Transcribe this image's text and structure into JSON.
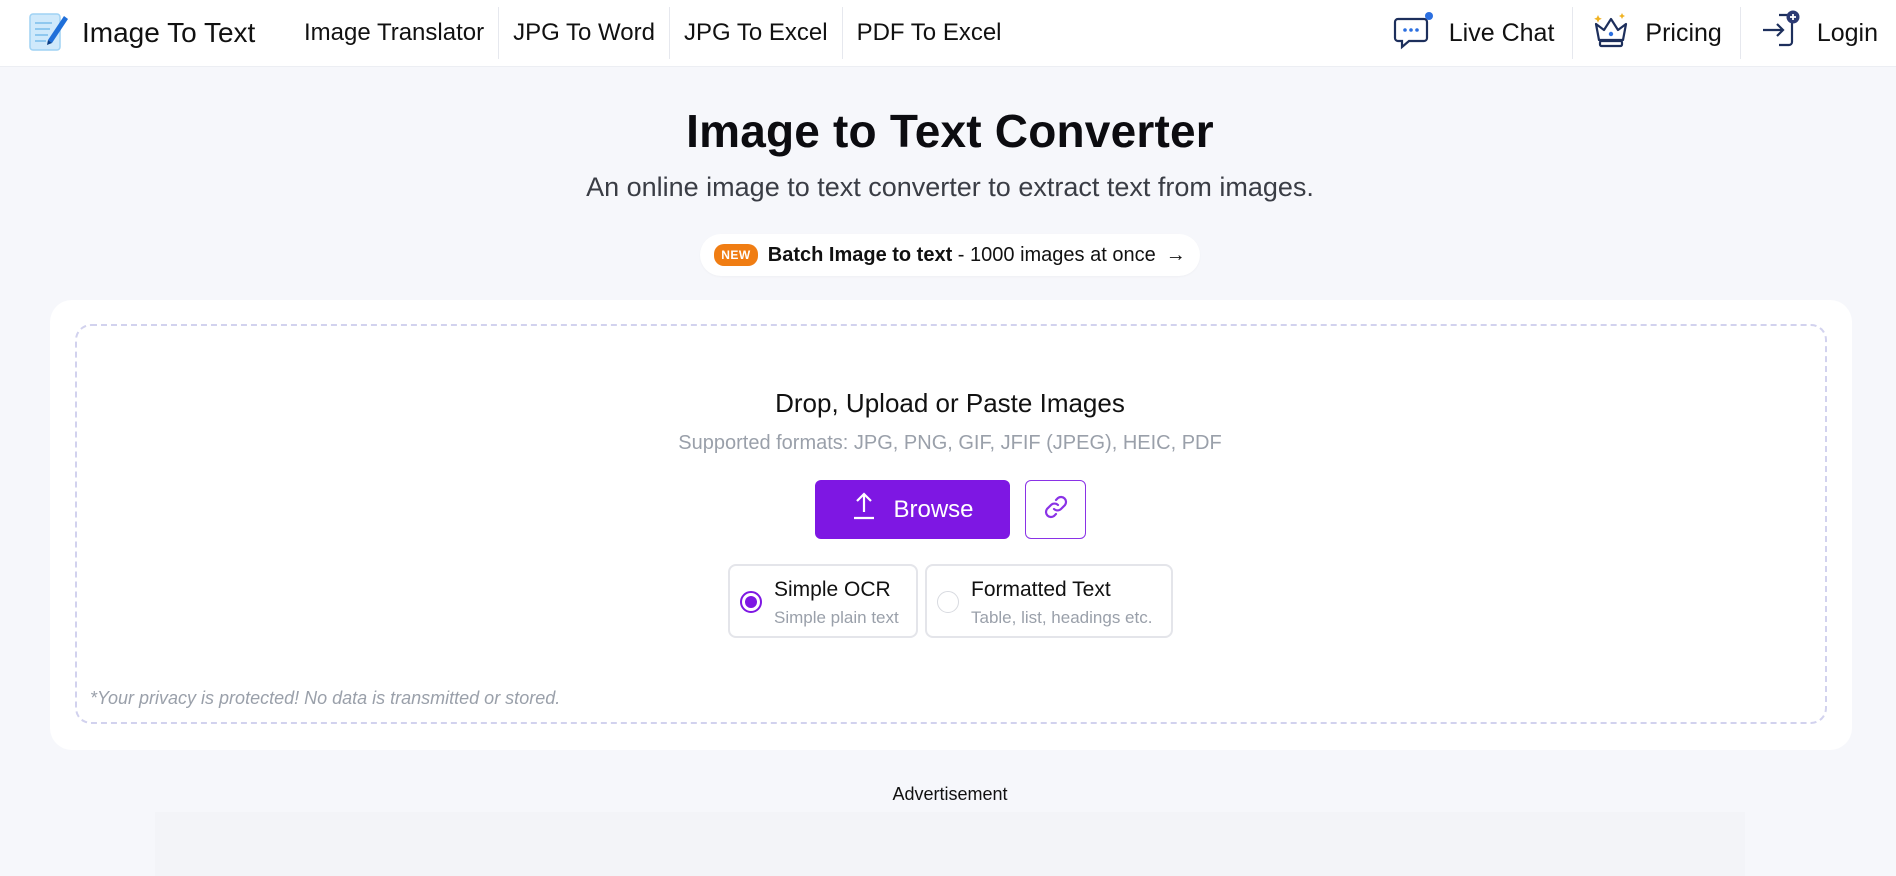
{
  "header": {
    "logo_text": "Image To Text",
    "nav": [
      "Image Translator",
      "JPG To Word",
      "JPG To Excel",
      "PDF To Excel"
    ],
    "live_chat": "Live Chat",
    "pricing": "Pricing",
    "login": "Login"
  },
  "hero": {
    "title": "Image to Text Converter",
    "subtitle": "An online image to text converter to extract text from images.",
    "batch_badge": "NEW",
    "batch_bold": "Batch Image to text",
    "batch_rest": " - 1000 images at once",
    "batch_arrow": "→"
  },
  "upload": {
    "title": "Drop, Upload or Paste Images",
    "formats": "Supported formats: JPG, PNG, GIF, JFIF (JPEG), HEIC, PDF",
    "browse_label": "Browse",
    "options": [
      {
        "title": "Simple OCR",
        "subtitle": "Simple plain text",
        "selected": true
      },
      {
        "title": "Formatted Text",
        "subtitle": "Table, list, headings etc.",
        "selected": false
      }
    ],
    "privacy": "*Your privacy is protected! No data is transmitted or stored."
  },
  "advertisement": "Advertisement",
  "icons": {
    "logo": "document-pen-icon",
    "live_chat": "chat-bubble-icon",
    "pricing": "crown-icon",
    "login": "login-arrow-icon",
    "browse": "upload-icon",
    "link": "link-icon"
  },
  "colors": {
    "accent": "#7e17e3",
    "badge": "#f07d13",
    "background": "#f6f7fb"
  }
}
